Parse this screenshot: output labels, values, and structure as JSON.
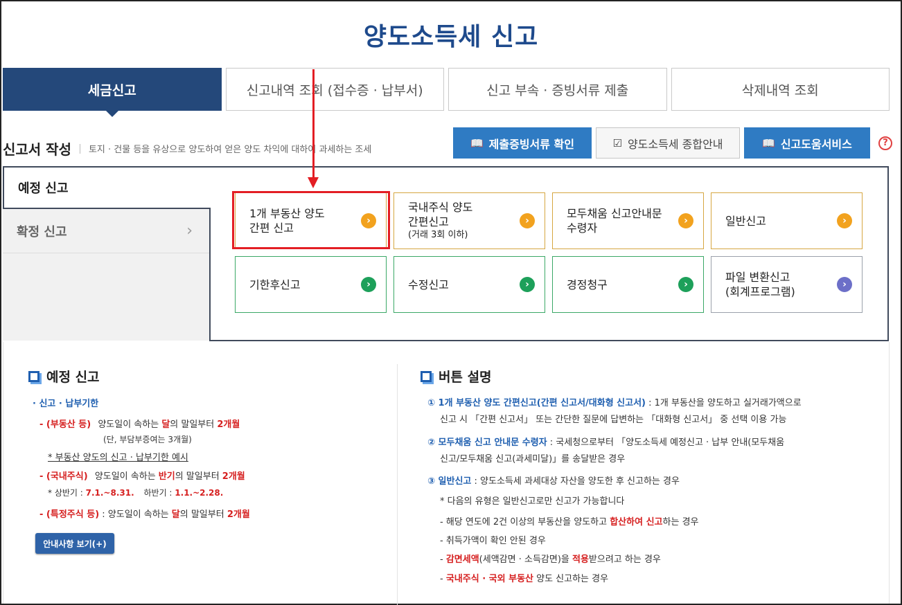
{
  "page_title": "양도소득세 신고",
  "tabs": [
    {
      "label": "세금신고"
    },
    {
      "label": "신고내역 조회 (접수증 · 납부서)"
    },
    {
      "label": "신고 부속 · 증빙서류 제출"
    },
    {
      "label": "삭제내역 조회"
    }
  ],
  "section": {
    "title": "신고서 작성",
    "description": "토지 · 건물 등을 유상으로 양도하여 얻은 양도 차익에 대하여 과세하는 조세"
  },
  "top_buttons": {
    "evidence": "제출증빙서류 확인",
    "guide": "양도소득세 종합안내",
    "help_service": "신고도움서비스",
    "help_icon": "?"
  },
  "sidebar": {
    "items": [
      {
        "label": "예정 신고"
      },
      {
        "label": "확정 신고"
      }
    ]
  },
  "cards": [
    {
      "line1": "1개 부동산 양도",
      "line2": "간편 신고",
      "sub": "",
      "arrow": "›",
      "color": "orange"
    },
    {
      "line1": "국내주식 양도",
      "line2": "간편신고",
      "sub": "(거래 3회 이하)",
      "arrow": "›",
      "color": "orange"
    },
    {
      "line1": "모두채움 신고안내문",
      "line2": "수령자",
      "sub": "",
      "arrow": "›",
      "color": "orange"
    },
    {
      "line1": "일반신고",
      "line2": "",
      "sub": "",
      "arrow": "›",
      "color": "orange"
    },
    {
      "line1": "기한후신고",
      "line2": "",
      "sub": "",
      "arrow": "›",
      "color": "green"
    },
    {
      "line1": "수정신고",
      "line2": "",
      "sub": "",
      "arrow": "›",
      "color": "green"
    },
    {
      "line1": "경정청구",
      "line2": "",
      "sub": "",
      "arrow": "›",
      "color": "green"
    },
    {
      "line1": "파일 변환신고",
      "line2": "(회계프로그램)",
      "sub": "",
      "arrow": "›",
      "color": "purple"
    }
  ],
  "left_info": {
    "title": "예정 신고",
    "deadline_heading": "· 신고 · 납부기한",
    "r1_tag": "- (부동산 등)",
    "r1_a": "양도일이 속하는 ",
    "r1_b": "달",
    "r1_c": "의 말일부터 ",
    "r1_d": "2개월",
    "r1_note": "(단, 부담부증여는 3개월)",
    "r1_link": "* 부동산 양도의 신고 · 납부기한 예시",
    "r2_tag": "- (국내주식)",
    "r2_a": "양도일이 속하는 ",
    "r2_b": "반기",
    "r2_c": "의 말일부터 ",
    "r2_d": "2개월",
    "r2_note_a": "* 상반기 : ",
    "r2_note_b": "7.1.~8.31.",
    "r2_note_c": "하반기 : ",
    "r2_note_d": "1.1.~2.28.",
    "r3_tag": "- (특정주식 등)",
    "r3_a": " : 양도일이 속하는 ",
    "r3_b": "달",
    "r3_c": "의 말일부터 ",
    "r3_d": "2개월",
    "more_button": "안내사항 보기(+)"
  },
  "right_info": {
    "title": "버튼 설명",
    "i1_head": "① 1개 부동산 양도 간편신고(간편 신고서/대화형 신고서)",
    "i1_a": " : 1개 부동산을 양도하고 실거래가액으로",
    "i1_b": "신고 시 「간편 신고서」 또는 간단한 질문에 답변하는 「대화형 신고서」 중 선택 이용 가능",
    "i2_head": "② 모두채움 신고 안내문 수령자",
    "i2_a": " : 국세청으로부터 「양도소득세 예정신고 · 납부 안내(모두채움",
    "i2_b": "신고/모두채움 신고(과세미달)」를 송달받은 경우",
    "i3_head": "③ 일반신고",
    "i3_a": " : 양도소득세 과세대상 자산을 양도한 후 신고하는 경우",
    "i3_note": "* 다음의 유형은 일반신고로만 신고가 가능합니다",
    "s1_a": "- 해당 연도에 2건 이상의 부동산을 양도하고 ",
    "s1_b": "합산하여 신고",
    "s1_c": "하는 경우",
    "s2": "- 취득가액이 확인 안된 경우",
    "s3_a": "- ",
    "s3_b": "감면세액",
    "s3_c": "(세액감면 · 소득감면)을 ",
    "s3_d": "적용",
    "s3_e": "받으려고 하는 경우",
    "s4_a": "- ",
    "s4_b": "국내주식 · 국외 부동산",
    "s4_c": " 양도 신고하는 경우"
  },
  "colors": {
    "brand_navy": "#24487a",
    "title_blue": "#1e4a8c",
    "button_blue": "#2f7bc3",
    "highlight_red": "#e31e24",
    "card_orange": "#f2a21e",
    "card_green": "#1da05a",
    "card_purple": "#6c6fc8"
  }
}
